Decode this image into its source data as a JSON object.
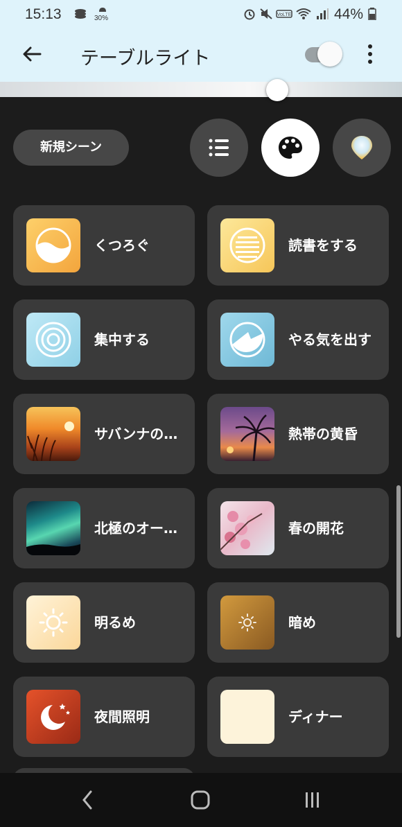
{
  "status": {
    "time": "15:13",
    "small_label": "30%",
    "battery": "44%"
  },
  "header": {
    "title": "テーブルライト",
    "power_on": true
  },
  "brightness": {
    "level": 0.69
  },
  "controls": {
    "new_scene": "新規シーン",
    "modes": [
      "list-icon",
      "palette-icon",
      "color-picker-icon"
    ],
    "active_mode": "palette-icon"
  },
  "scenes": [
    {
      "label": "くつろぐ",
      "icon": "relax-icon"
    },
    {
      "label": "読書をする",
      "icon": "read-icon"
    },
    {
      "label": "集中する",
      "icon": "concentrate-icon"
    },
    {
      "label": "やる気を出す",
      "icon": "energize-icon"
    },
    {
      "label": "サバンナの…",
      "icon": "savanna-photo"
    },
    {
      "label": "熱帯の黄昏",
      "icon": "tropical-twilight-photo"
    },
    {
      "label": "北極のオー…",
      "icon": "aurora-photo"
    },
    {
      "label": "春の開花",
      "icon": "spring-blossom-photo"
    },
    {
      "label": "明るめ",
      "icon": "bright-icon"
    },
    {
      "label": "暗め",
      "icon": "dimmed-icon"
    },
    {
      "label": "夜間照明",
      "icon": "nightlight-icon"
    },
    {
      "label": "ディナー",
      "icon": "dinner-swatch"
    }
  ],
  "colors": {
    "header_bg": "#dff3fb",
    "background": "#1c1c1c",
    "card": "#3a3a3a",
    "pill": "#474747"
  }
}
